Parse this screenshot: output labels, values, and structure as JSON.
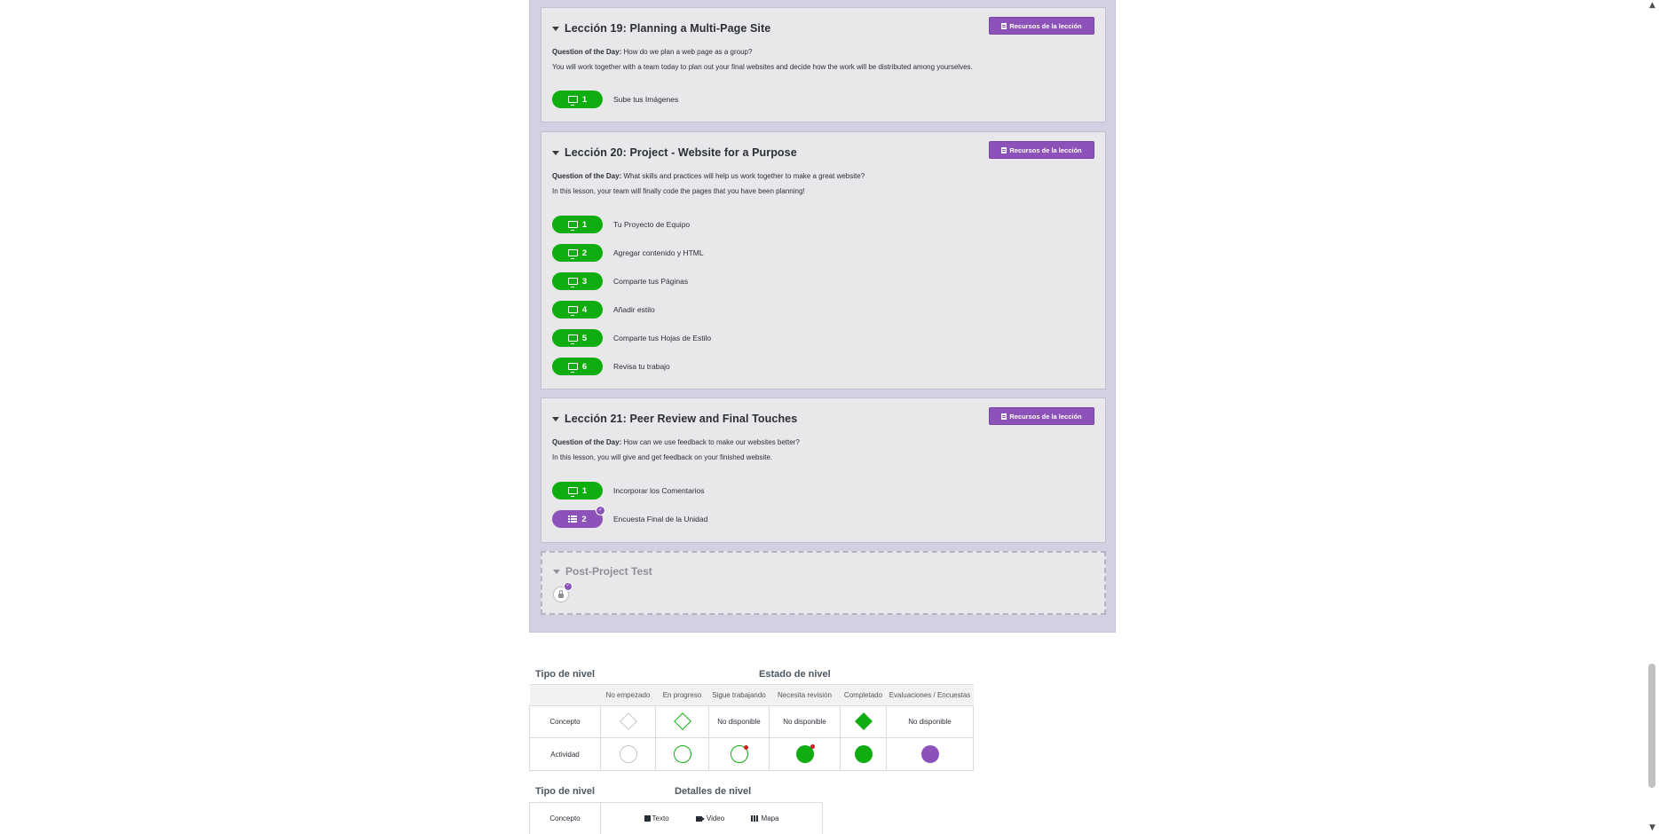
{
  "lessons": [
    {
      "title": "Lección 19: Planning a Multi-Page Site",
      "resources_label": "Recursos de la lección",
      "qotd_label": "Question of the Day:",
      "qotd": "How do we plan a web page as a group?",
      "description": "You will work together with a team today to plan out your final websites and decide how the work will be distributed among yourselves.",
      "levels": [
        {
          "num": "1",
          "name": "Sube tus Imágenes",
          "icon": "monitor-icon",
          "kind": "activity"
        }
      ]
    },
    {
      "title": "Lección 20: Project - Website for a Purpose",
      "resources_label": "Recursos de la lección",
      "qotd_label": "Question of the Day:",
      "qotd": "What skills and practices will help us work together to make a great website?",
      "description": "In this lesson, your team will finally code the pages that you have been planning!",
      "levels": [
        {
          "num": "1",
          "name": "Tu Proyecto de Equipo",
          "icon": "monitor-icon",
          "kind": "activity"
        },
        {
          "num": "2",
          "name": "Agregar contenido y HTML",
          "icon": "monitor-icon",
          "kind": "activity"
        },
        {
          "num": "3",
          "name": "Comparte tus Páginas",
          "icon": "monitor-icon",
          "kind": "activity"
        },
        {
          "num": "4",
          "name": "Añadir estilo",
          "icon": "monitor-icon",
          "kind": "activity"
        },
        {
          "num": "5",
          "name": "Comparte tus Hojas de Estilo",
          "icon": "monitor-icon",
          "kind": "activity"
        },
        {
          "num": "6",
          "name": "Revisa tu trabajo",
          "icon": "monitor-icon",
          "kind": "activity"
        }
      ]
    },
    {
      "title": "Lección 21: Peer Review and Final Touches",
      "resources_label": "Recursos de la lección",
      "qotd_label": "Question of the Day:",
      "qotd": "How can we use feedback to make our websites better?",
      "description": "In this lesson, you will give and get feedback on your finished website.",
      "levels": [
        {
          "num": "1",
          "name": "Incorporar los Comentarios",
          "icon": "monitor-icon",
          "kind": "activity"
        },
        {
          "num": "2",
          "name": "Encuesta Final de la Unidad",
          "icon": "list-icon",
          "kind": "survey"
        }
      ]
    }
  ],
  "post_project": {
    "title": "Post-Project Test",
    "icon": "lock-icon"
  },
  "key_status": {
    "type_header": "Tipo de nivel",
    "status_header": "Estado de nivel",
    "columns": [
      "No empezado",
      "En progreso",
      "Sigue trabajando",
      "Necesita revisión",
      "Completado",
      "Evaluaciones / Encuestas"
    ],
    "rows": [
      {
        "label": "Concepto",
        "na": "No disponible"
      },
      {
        "label": "Actividad"
      }
    ]
  },
  "key_details": {
    "type_header": "Tipo de nivel",
    "details_header": "Detalles de nivel",
    "row_label": "Concepto",
    "items": [
      {
        "label": "Texto",
        "icon": "document-icon"
      },
      {
        "label": "Video",
        "icon": "video-icon"
      },
      {
        "label": "Mapa",
        "icon": "map-icon"
      }
    ]
  },
  "colors": {
    "green": "#0fad0f",
    "purple": "#8c52ba",
    "unit_bg": "#d4d0e4",
    "lesson_bg": "#e8e8ea",
    "red": "#d11f1f"
  }
}
